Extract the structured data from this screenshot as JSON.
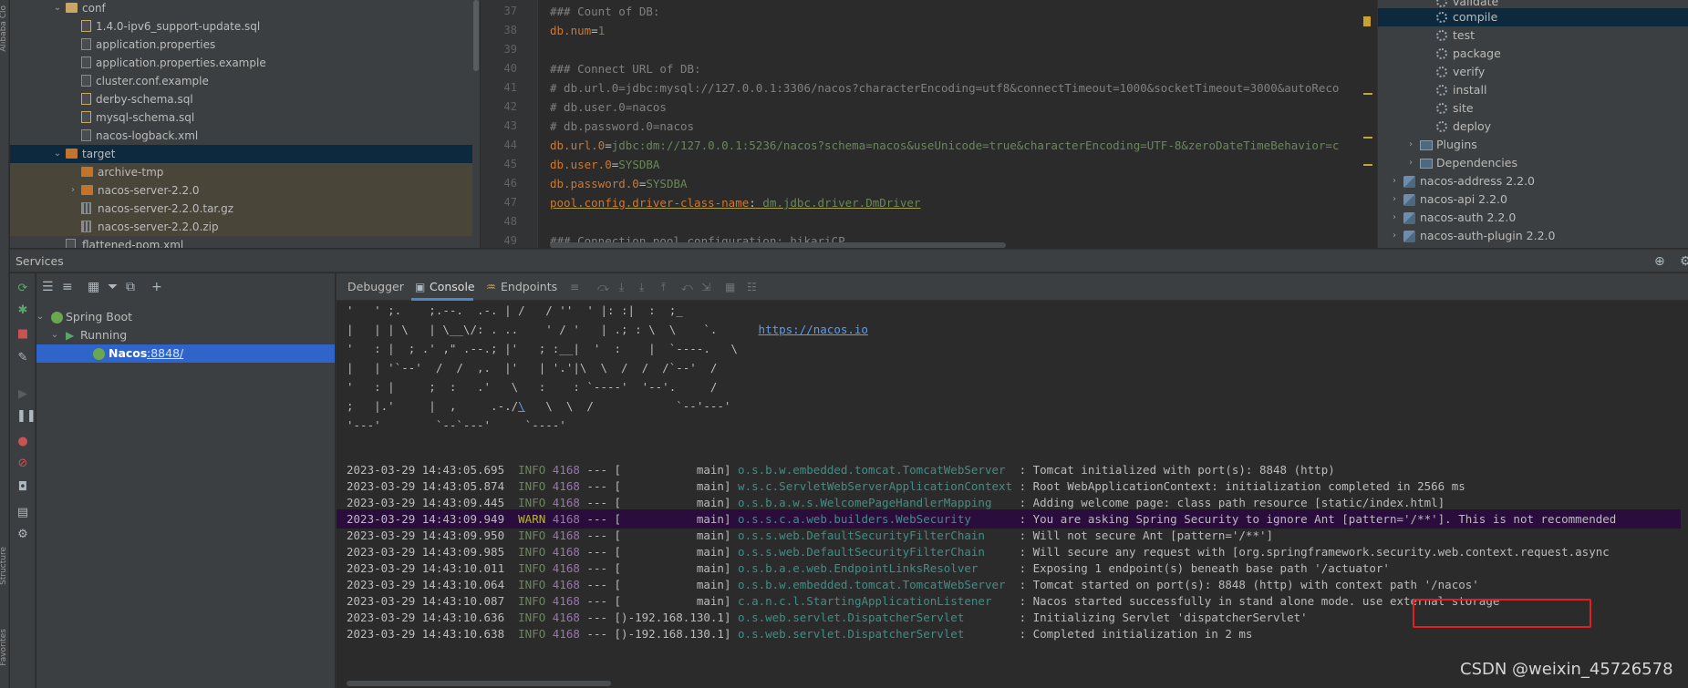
{
  "left_strip": {
    "top_label": "Alibaba Clo",
    "structure_label": "Structure",
    "favorites_label": "Favorites"
  },
  "project_tree": {
    "rows": [
      {
        "label": "conf",
        "kind": "folder"
      },
      {
        "label": "1.4.0-ipv6_support-update.sql",
        "kind": "sql"
      },
      {
        "label": "application.properties",
        "kind": "props"
      },
      {
        "label": "application.properties.example",
        "kind": "props"
      },
      {
        "label": "cluster.conf.example",
        "kind": "file"
      },
      {
        "label": "derby-schema.sql",
        "kind": "sql"
      },
      {
        "label": "mysql-schema.sql",
        "kind": "sql"
      },
      {
        "label": "nacos-logback.xml",
        "kind": "xml"
      },
      {
        "label": "target",
        "kind": "folder-orange"
      },
      {
        "label": "archive-tmp",
        "kind": "folder-orange"
      },
      {
        "label": "nacos-server-2.2.0",
        "kind": "folder-orange"
      },
      {
        "label": "nacos-server-2.2.0.tar.gz",
        "kind": "archive"
      },
      {
        "label": "nacos-server-2.2.0.zip",
        "kind": "zip"
      },
      {
        "label": "flattened-pom.xml",
        "kind": "xml"
      }
    ]
  },
  "editor": {
    "line_numbers": [
      "37",
      "38",
      "39",
      "40",
      "41",
      "42",
      "43",
      "44",
      "45",
      "46",
      "47",
      "48",
      "49"
    ],
    "lines": {
      "l37": "### Count of DB:",
      "l38_key": "db.num",
      "l38_val": "1",
      "l40": "### Connect URL of DB:",
      "l41": "# db.url.0=jdbc:mysql://127.0.0.1:3306/nacos?characterEncoding=utf8&connectTimeout=1000&socketTimeout=3000&autoReco",
      "l42": "# db.user.0=nacos",
      "l43": "# db.password.0=nacos",
      "l44_key": "db.url.0",
      "l44_val": "jdbc:dm://127.0.0.1:5236/nacos?schema=nacos&useUnicode=true&characterEncoding=UTF-8&zeroDateTimeBehavior=c",
      "l45_key": "db.user.0",
      "l45_val": "SYSDBA",
      "l46_key": "db.password.0",
      "l46_val": "SYSDBA",
      "l47_key": "pool.config.driver-class-name",
      "l47_val": " dm.jdbc.driver.DmDriver",
      "l49": "### Connection pool configuration: hikariCP"
    }
  },
  "maven_panel": {
    "lifecycle": [
      "validate",
      "compile",
      "test",
      "package",
      "verify",
      "install",
      "site",
      "deploy"
    ],
    "groups": [
      "Plugins",
      "Dependencies"
    ],
    "modules": [
      "nacos-address 2.2.0",
      "nacos-api 2.2.0",
      "nacos-auth 2.2.0",
      "nacos-auth-plugin 2.2.0"
    ]
  },
  "services": {
    "title": "Services",
    "tree": {
      "root": "Spring Boot",
      "group": "Running",
      "app": "Nacos",
      "port": ":8848/"
    }
  },
  "console": {
    "tabs": {
      "debugger": "Debugger",
      "console": "Console",
      "endpoints": "Endpoints"
    },
    "ascii_lines": [
      "'   ' ;.    ;.--.  .-. | /   / ''  ' |: :|  :  ;_",
      "|   | | \\   | \\__\\/: . ..    ' / '   | .; : \\  \\    `.      ",
      "'   : |  ; .' ,\" .--.; |'   ; :__|  '  :    |  `----.   \\",
      "|   | '`--'  /  /  ,.  |'   | '.'|\\  \\  /  /  /`--'  /",
      "'   : |     ;  :   .'   \\   :    : `----'  '--'.     /",
      ";   |.'     |  ,     .-./",
      "'---'        `--`---'     `----'"
    ],
    "ascii_tail_line6": "   \\  \\  /            `--'---'",
    "ascii_slash_link": "\\",
    "url": "https://nacos.io",
    "logs": [
      {
        "time": "2023-03-29 14:43:05.695",
        "level": "INFO",
        "pid": "4168",
        "sep": " --- [           main]",
        "logger": "o.s.b.w.embedded.tomcat.TomcatWebServer  ",
        "msg": ": Tomcat initialized with port(s): 8848 (http)"
      },
      {
        "time": "2023-03-29 14:43:05.874",
        "level": "INFO",
        "pid": "4168",
        "sep": " --- [           main]",
        "logger": "w.s.c.ServletWebServerApplicationContext ",
        "msg": ": Root WebApplicationContext: initialization completed in 2566 ms"
      },
      {
        "time": "2023-03-29 14:43:09.445",
        "level": "INFO",
        "pid": "4168",
        "sep": " --- [           main]",
        "logger": "o.s.b.a.w.s.WelcomePageHandlerMapping    ",
        "msg": ": Adding welcome page: class path resource [static/index.html]"
      },
      {
        "time": "2023-03-29 14:43:09.949",
        "level": "WARN",
        "pid": "4168",
        "sep": " --- [           main]",
        "logger": "o.s.s.c.a.web.builders.WebSecurity       ",
        "msg": ": You are asking Spring Security to ignore Ant [pattern='/**']. This is not recommended"
      },
      {
        "time": "2023-03-29 14:43:09.950",
        "level": "INFO",
        "pid": "4168",
        "sep": " --- [           main]",
        "logger": "o.s.s.web.DefaultSecurityFilterChain     ",
        "msg": ": Will not secure Ant [pattern='/**']"
      },
      {
        "time": "2023-03-29 14:43:09.985",
        "level": "INFO",
        "pid": "4168",
        "sep": " --- [           main]",
        "logger": "o.s.s.web.DefaultSecurityFilterChain     ",
        "msg": ": Will secure any request with [org.springframework.security.web.context.request.async"
      },
      {
        "time": "2023-03-29 14:43:10.011",
        "level": "INFO",
        "pid": "4168",
        "sep": " --- [           main]",
        "logger": "o.s.b.a.e.web.EndpointLinksResolver      ",
        "msg": ": Exposing 1 endpoint(s) beneath base path '/actuator'"
      },
      {
        "time": "2023-03-29 14:43:10.064",
        "level": "INFO",
        "pid": "4168",
        "sep": " --- [           main]",
        "logger": "o.s.b.w.embedded.tomcat.TomcatWebServer  ",
        "msg": ": Tomcat started on port(s): 8848 (http) with context path '/nacos'"
      },
      {
        "time": "2023-03-29 14:43:10.087",
        "level": "INFO",
        "pid": "4168",
        "sep": " --- [           main]",
        "logger": "c.a.n.c.l.StartingApplicationListener    ",
        "msg": ": Nacos started successfully in stand alone mode. use external storage"
      },
      {
        "time": "2023-03-29 14:43:10.636",
        "level": "INFO",
        "pid": "4168",
        "sep": " --- [)-192.168.130.1]",
        "logger": "o.s.web.servlet.DispatcherServlet        ",
        "msg": ": Initializing Servlet 'dispatcherServlet'"
      },
      {
        "time": "2023-03-29 14:43:10.638",
        "level": "INFO",
        "pid": "4168",
        "sep": " --- [)-192.168.130.1]",
        "logger": "o.s.web.servlet.DispatcherServlet        ",
        "msg": ": Completed initialization in 2 ms"
      }
    ]
  },
  "watermark": "CSDN @weixin_45726578",
  "colors": {
    "highlight_box": "#e02020",
    "selection": "#2f65ca",
    "warn_row_bg": "#2a0d3d"
  }
}
